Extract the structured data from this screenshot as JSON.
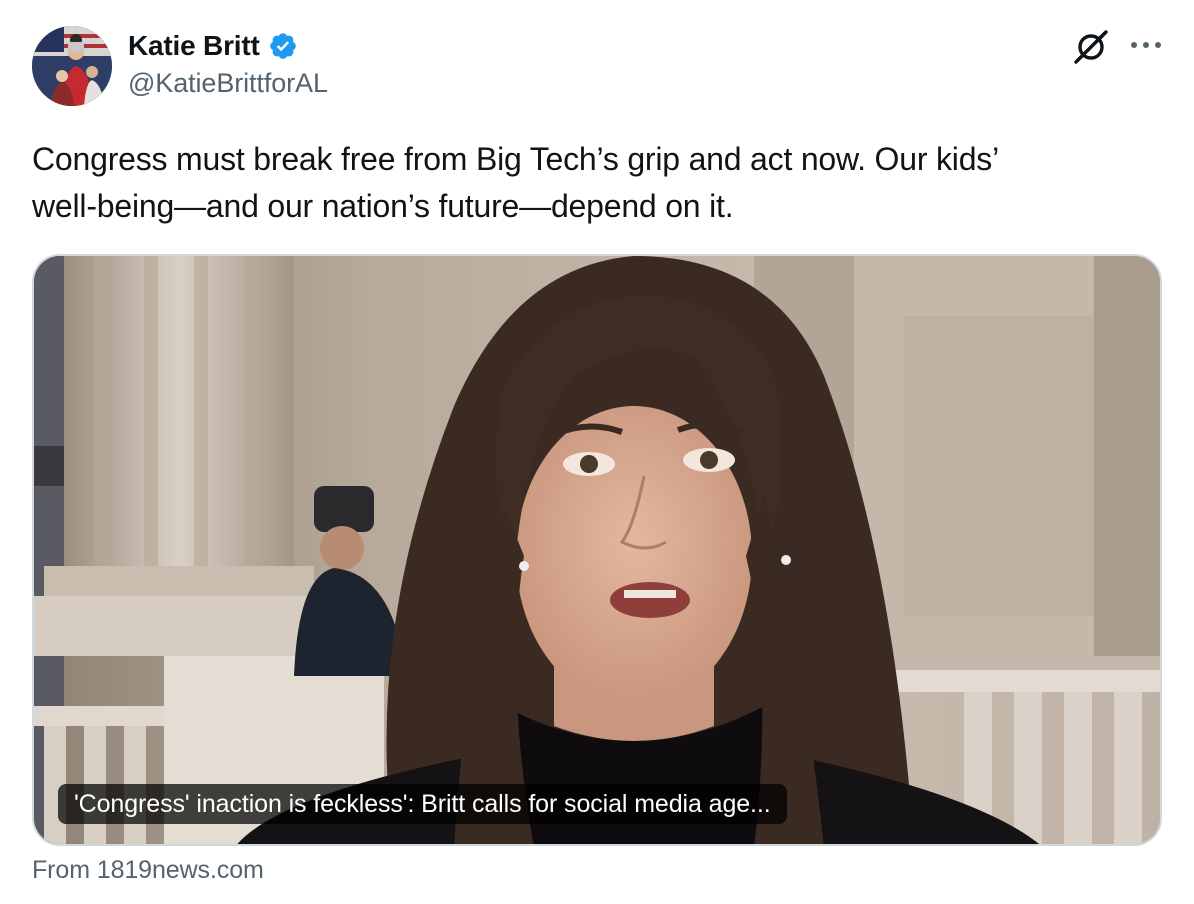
{
  "author": {
    "display_name": "Katie Britt",
    "handle": "@KatieBrittforAL",
    "verified": true,
    "avatar_icon": "profile-photo"
  },
  "actions": {
    "grok_icon": "grok-icon",
    "more_icon": "more-options-icon"
  },
  "tweet": {
    "text_line1": "Congress must break free from Big Tech’s grip and act now. Our kids’",
    "text_line2": "well-being—and our nation’s future—depend on it."
  },
  "link_card": {
    "caption": "'Congress' inaction is feckless': Britt calls for social media age...",
    "source": "From 1819news.com"
  },
  "colors": {
    "verified_blue": "#1d9bf0",
    "secondary_text": "#536471",
    "primary_text": "#0f1419",
    "card_border": "#cfd9de"
  }
}
